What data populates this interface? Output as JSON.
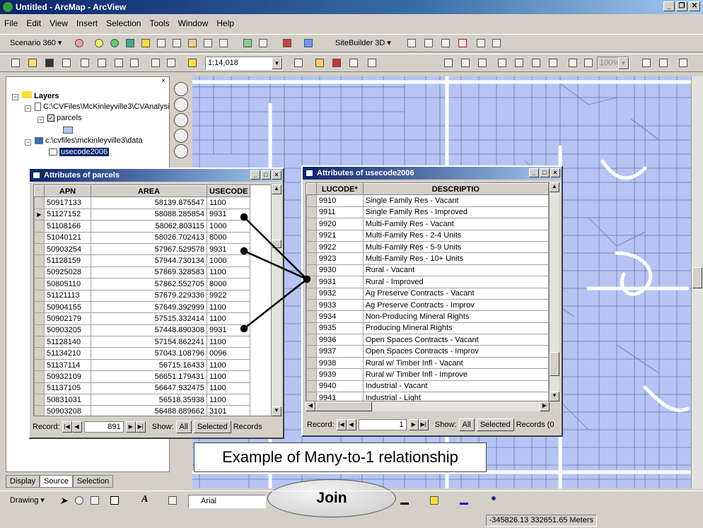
{
  "window": {
    "title": "Untitled - ArcMap - ArcView",
    "buttons": [
      "_",
      "❐",
      "✕"
    ]
  },
  "menu": [
    "File",
    "Edit",
    "View",
    "Insert",
    "Selection",
    "Tools",
    "Window",
    "Help"
  ],
  "toolbar1": {
    "scenario": "Scenario 360",
    "sitebuilder": "SiteBuilder 3D"
  },
  "toolbar2": {
    "scale": "1:14,018",
    "zoom": "100%"
  },
  "toc": {
    "root": "Layers",
    "path1": "C:\\CVFiles\\McKinleyville3\\CVAnalysi",
    "layer1": "parcels",
    "path2": "c:\\cvfiles\\mckinleyville3\\data",
    "table": "usecode2006",
    "tabs": [
      "Display",
      "Source",
      "Selection"
    ]
  },
  "parcels_window": {
    "title": "Attributes of parcels",
    "headers": [
      "APN",
      "AREA",
      "USECODE"
    ],
    "rows": [
      [
        "50917133",
        "58139.875547",
        "1100"
      ],
      [
        "51127152",
        "58088.285854",
        "9931"
      ],
      [
        "51108166",
        "58062.803115",
        "1000"
      ],
      [
        "51040121",
        "58026.702413",
        "8000"
      ],
      [
        "50903254",
        "57967.529578",
        "9931"
      ],
      [
        "51128159",
        "57944.730134",
        "1000"
      ],
      [
        "50925028",
        "57869.328583",
        "1100"
      ],
      [
        "50805110",
        "57862.552705",
        "8000"
      ],
      [
        "51121113",
        "57679.229336",
        "9922"
      ],
      [
        "50904155",
        "57649.392999",
        "1100"
      ],
      [
        "50902179",
        "57515.332414",
        "1100"
      ],
      [
        "50903205",
        "57448.890308",
        "9931"
      ],
      [
        "51128140",
        "57154.862241",
        "1100"
      ],
      [
        "51134210",
        "57043.108796",
        "0096"
      ],
      [
        "51137114",
        "56715.16433",
        "1100"
      ],
      [
        "50932109",
        "56651.179431",
        "1100"
      ],
      [
        "51137105",
        "56647.932475",
        "1100"
      ],
      [
        "50831031",
        "56518.35938",
        "1100"
      ],
      [
        "50903208",
        "56488.889662",
        "3101"
      ]
    ],
    "record_label": "Record:",
    "record_value": "891",
    "show_label": "Show:",
    "all": "All",
    "selected": "Selected",
    "records": "Records"
  },
  "usecode_window": {
    "title": "Attributes of usecode2006",
    "headers": [
      "LUCODE*",
      "DESCRIPTIO"
    ],
    "rows": [
      [
        "9910",
        "Single Family Res - Vacant"
      ],
      [
        "9911",
        "Single Family Res - Improved"
      ],
      [
        "9920",
        "Multi-Family Res - Vacant"
      ],
      [
        "9921",
        "Multi-Family Res - 2-4 Units"
      ],
      [
        "9922",
        "Multi-Family Res - 5-9 Units"
      ],
      [
        "9923",
        "Multi-Family Res - 10+ Units"
      ],
      [
        "9930",
        "Rural - Vacant"
      ],
      [
        "9931",
        "Rural - Improved"
      ],
      [
        "9932",
        "Ag Preserve Contracts - Vacant"
      ],
      [
        "9933",
        "Ag Preserve Contracts - Improv"
      ],
      [
        "9934",
        "Non-Producing Mineral Rights"
      ],
      [
        "9935",
        "Producing Mineral Rights"
      ],
      [
        "9936",
        "Open Spaces Contracts - Vacant"
      ],
      [
        "9937",
        "Open Spaces Contracts - Improv"
      ],
      [
        "9938",
        "Rural w/ Timber Infl - Vacant"
      ],
      [
        "9939",
        "Rural w/ Timber Infl - Improve"
      ],
      [
        "9940",
        "Industrial - Vacant"
      ],
      [
        "9941",
        "Industrial - Light"
      ]
    ],
    "record_label": "Record:",
    "record_value": "1",
    "show_label": "Show:",
    "all": "All",
    "selected": "Selected",
    "records": "Records (0"
  },
  "caption": "Example of Many-to-1 relationship",
  "join": "Join",
  "drawing": {
    "label": "Drawing",
    "font": "Arial"
  },
  "status": {
    "coords": "-345826.13  332651.65 Meters"
  },
  "colors": {
    "map_bg": "#b5c4f2",
    "title_start": "#0a246a",
    "title_end": "#a6caf0"
  }
}
